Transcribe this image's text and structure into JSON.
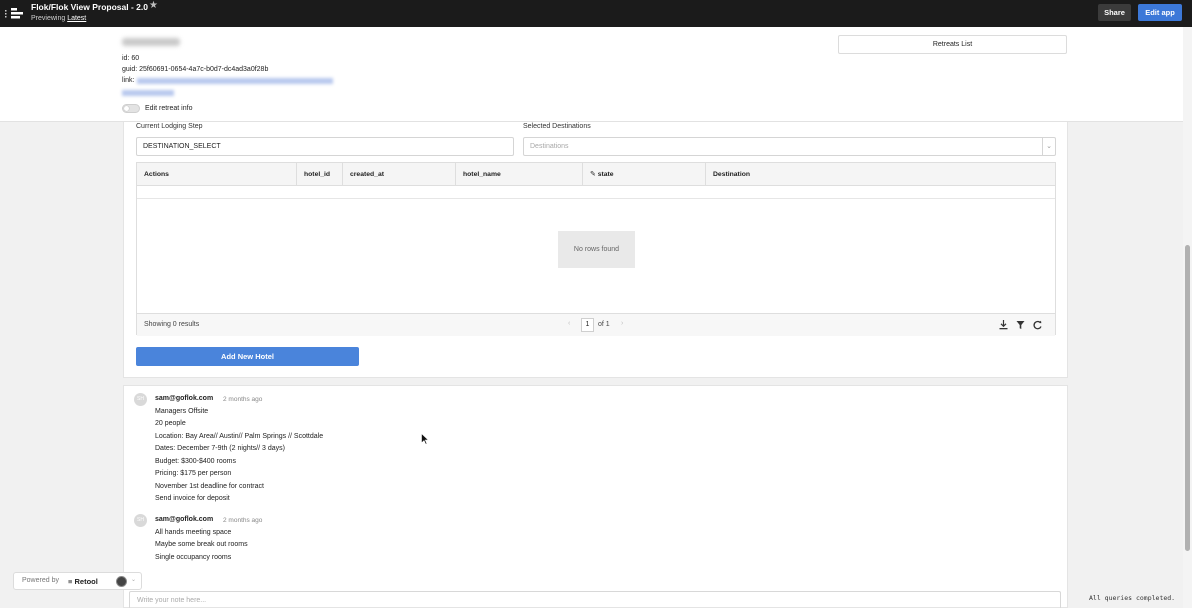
{
  "topbar": {
    "title": "Flok/Flok View Proposal - 2.0",
    "subtitle_prefix": "Previewing ",
    "subtitle_link": "Latest",
    "share_label": "Share",
    "edit_label": "Edit app"
  },
  "retreat_info": {
    "id_line": "id: 60",
    "guid_line": "guid: 25f60691-0654-4a7c-b0d7-dc4ad3a0f28b",
    "link_label": "link:",
    "toggle_label": "Edit retreat info",
    "retreats_list_label": "Retreats List"
  },
  "lodging": {
    "step_label": "Current Lodging Step",
    "step_value": "DESTINATION_SELECT",
    "destinations_label": "Selected Destinations",
    "destinations_placeholder": "Destinations",
    "columns": [
      "Actions",
      "hotel_id",
      "created_at",
      "hotel_name",
      "state",
      "Destination"
    ],
    "empty_text": "No rows found",
    "showing_text": "Showing 0 results",
    "page_current": "1",
    "page_total_text": "of 1",
    "add_button": "Add New Hotel"
  },
  "notes": [
    {
      "avatar": "SH",
      "author": "sam@goflok.com",
      "time": "2 months ago",
      "lines": [
        "Managers Offsite",
        "20 people",
        "Location: Bay Area// Austin// Palm Springs // Scottdale",
        "Dates: December 7-9th (2 nights// 3 days)",
        "Budget: $300-$400 rooms",
        "Pricing: $175 per person",
        "November 1st deadline for contract",
        "Send invoice for deposit"
      ]
    },
    {
      "avatar": "SH",
      "author": "sam@goflok.com",
      "time": "2 months ago",
      "lines": [
        "All hands meeting space",
        "Maybe some break out rooms",
        "Single occupancy rooms"
      ]
    }
  ],
  "note_input_placeholder": "Write your note here...",
  "powered_by": {
    "text": "Powered by",
    "brand": "Retool"
  },
  "status_text": "All queries completed.",
  "colors": {
    "primary": "#3c78d8",
    "topbar": "#1b1b1b",
    "add_button": "#4a84db"
  }
}
